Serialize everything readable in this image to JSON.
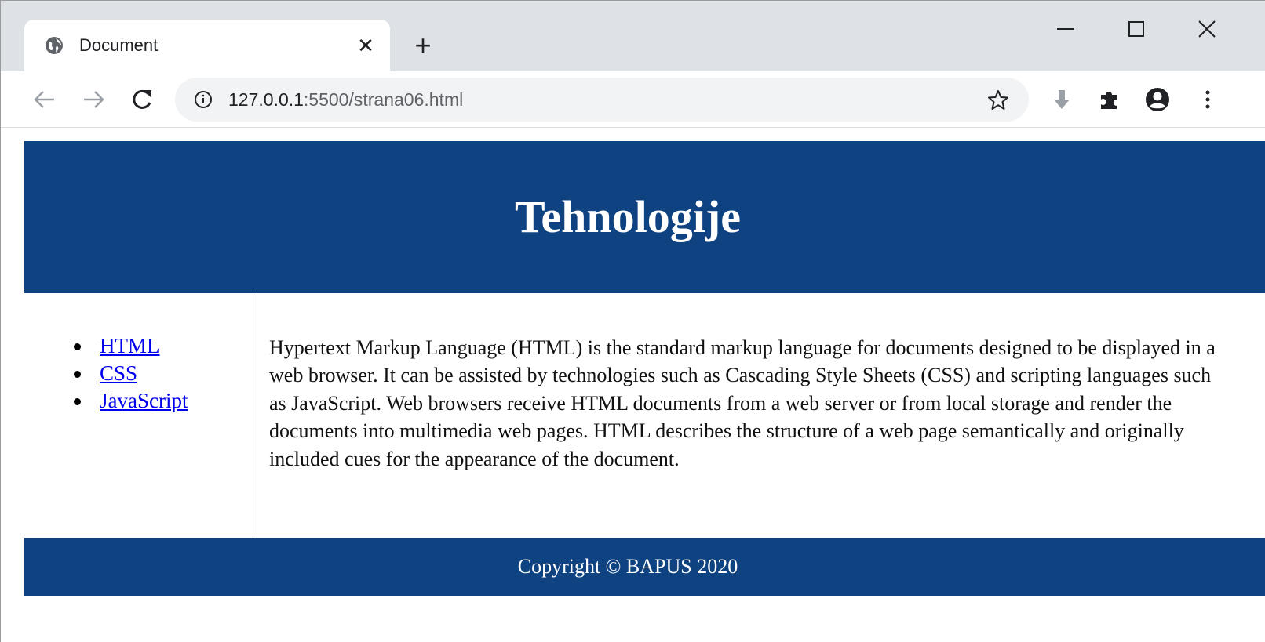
{
  "browser": {
    "tab": {
      "title": "Document",
      "icon": "globe-icon"
    },
    "new_tab_label": "+",
    "url_host": "127.0.0.1",
    "url_rest": ":5500/strana06.html",
    "colors": {
      "tabstrip": "#dee1e6",
      "omnibox": "#f1f3f4"
    }
  },
  "page": {
    "header_title": "Tehnologije",
    "nav_links": [
      {
        "label": "HTML"
      },
      {
        "label": "CSS"
      },
      {
        "label": "JavaScript"
      }
    ],
    "main_text": "Hypertext Markup Language (HTML) is the standard markup language for documents designed to be displayed in a web browser. It can be assisted by technologies such as Cascading Style Sheets (CSS) and scripting languages such as JavaScript. Web browsers receive HTML documents from a web server or from local storage and render the documents into multimedia web pages. HTML describes the structure of a web page semantically and originally included cues for the appearance of the document.",
    "footer_text": "Copyright © BAPUS 2020",
    "colors": {
      "header_bg": "#0e4280",
      "footer_bg": "#0e4280",
      "link": "#0000ee"
    }
  }
}
